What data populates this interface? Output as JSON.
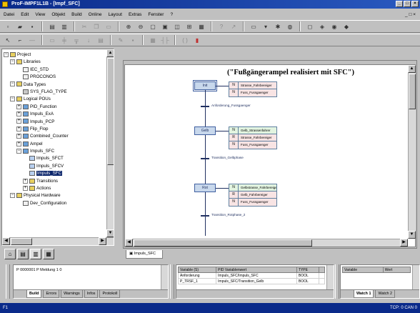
{
  "window": {
    "title": "ProF-IMPF1L1B - [Impf_SFC]",
    "controls": [
      "_",
      "□",
      "×"
    ]
  },
  "menu": {
    "items": [
      "Datei",
      "Edit",
      "View",
      "Objekt",
      "Build",
      "Online",
      "Layout",
      "Extras",
      "Fenster",
      "?"
    ],
    "right": "_ □ ×"
  },
  "tree": {
    "nodes": [
      {
        "pm": "−",
        "indent": 0,
        "icon": "folder",
        "label": "Project"
      },
      {
        "pm": "−",
        "indent": 1,
        "icon": "folder",
        "label": "Libraries"
      },
      {
        "pm": "",
        "indent": 2,
        "icon": "doc",
        "label": "IEC_STD"
      },
      {
        "pm": "",
        "indent": 2,
        "icon": "doc",
        "label": "PROCONOS"
      },
      {
        "pm": "−",
        "indent": 1,
        "icon": "folder",
        "label": "Data Types"
      },
      {
        "pm": "",
        "indent": 2,
        "icon": "dt",
        "label": "SYS_FLAG_TYPE"
      },
      {
        "pm": "−",
        "indent": 1,
        "icon": "folder",
        "label": "Logical POUs"
      },
      {
        "pm": "+",
        "indent": 2,
        "icon": "prog",
        "label": "PID_Function"
      },
      {
        "pm": "+",
        "indent": 2,
        "icon": "prog",
        "label": "Impuls_ExA"
      },
      {
        "pm": "+",
        "indent": 2,
        "icon": "prog",
        "label": "Impuls_PCP"
      },
      {
        "pm": "+",
        "indent": 2,
        "icon": "prog",
        "label": "Flip_Flop"
      },
      {
        "pm": "+",
        "indent": 2,
        "icon": "prog",
        "label": "Combined_Counter"
      },
      {
        "pm": "+",
        "indent": 2,
        "icon": "prog",
        "label": "Ampel"
      },
      {
        "pm": "−",
        "indent": 2,
        "icon": "prog",
        "label": "Impuls_SFC"
      },
      {
        "pm": "",
        "indent": 3,
        "icon": "sfc",
        "label": "Impuls_SFCT"
      },
      {
        "pm": "",
        "indent": 3,
        "icon": "sfc",
        "label": "Impuls_SFCV"
      },
      {
        "pm": "",
        "indent": 3,
        "icon": "sfc",
        "label": "Impuls_SFC",
        "selected": true
      },
      {
        "pm": "+",
        "indent": 3,
        "icon": "folder",
        "label": "Transitions"
      },
      {
        "pm": "+",
        "indent": 3,
        "icon": "folder",
        "label": "Actions"
      },
      {
        "pm": "−",
        "indent": 1,
        "icon": "folder",
        "label": "Physical Hardware"
      },
      {
        "pm": "",
        "indent": 2,
        "icon": "doc",
        "label": "Dev_Configuration"
      }
    ]
  },
  "editor": {
    "title": "(\"Fußgängerampel realisiert mit SFC\")",
    "tab_label": "Impuls_SFC",
    "steps": [
      {
        "label": "Init",
        "initial": true,
        "actions": [
          {
            "q": "N",
            "name": "Strasse_Fahrbereiger",
            "color": "pink"
          },
          {
            "q": "N",
            "name": "Fuss_Fussgaenger",
            "color": "pink"
          }
        ]
      },
      {
        "label": "Gelb",
        "initial": false,
        "actions": [
          {
            "q": "N",
            "name": "Gelb_Strassenfahrer",
            "color": "green"
          },
          {
            "q": "R",
            "name": "Strasse_Fahrbereiger",
            "color": "pink"
          },
          {
            "q": "N",
            "name": "Fuss_Fussgaenger",
            "color": "pink"
          }
        ]
      },
      {
        "label": "Rot",
        "initial": false,
        "actions": [
          {
            "q": "N",
            "name": "Gelbstrasse_Fahrbereiger",
            "color": "green"
          },
          {
            "q": "R",
            "name": "Gelb_Fahrbereiger",
            "color": "pink"
          },
          {
            "q": "N",
            "name": "Fuss_Fussgaenger",
            "color": "pink"
          }
        ]
      }
    ],
    "transitions": [
      "Anforderung_Fussgaenger",
      "Transition_Gelbphase",
      "Transition_Rotphase_2"
    ]
  },
  "bottom": {
    "messages": {
      "text": "P  0000001  P  Meldung 1 0",
      "tabs": [
        "Build",
        "Errors",
        "Warnings",
        "Infos",
        "Protokoll"
      ]
    },
    "variables": {
      "headers": [
        "Variable (S)",
        "PID Variablenwert",
        "TYPE",
        ""
      ],
      "rows": [
        [
          "Anforderung",
          "Impuls_SFC/Impuls_SFC",
          "BOOL",
          ""
        ],
        [
          "P_TRSF_1",
          "Impuls_SFC/Transition_Gelb",
          "BOOL",
          ""
        ]
      ]
    },
    "watch": {
      "headers": [
        "Variable",
        "Wert"
      ],
      "tabs": [
        "Watch 1",
        "Watch 2"
      ]
    }
  },
  "status": {
    "left": "F1",
    "right": "TCP: 0  CAN 0"
  }
}
